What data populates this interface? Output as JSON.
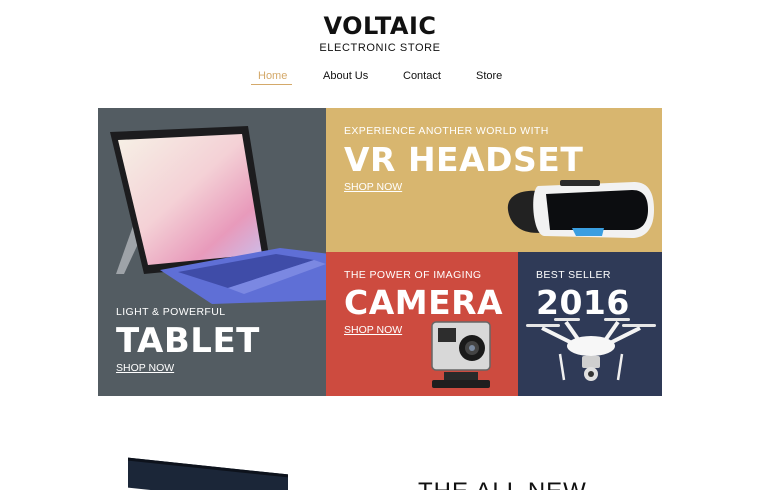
{
  "brand": {
    "title": "VOLTAIC",
    "subtitle": "ELECTRONIC STORE"
  },
  "nav": {
    "items": [
      {
        "label": "Home",
        "active": true
      },
      {
        "label": "About Us",
        "active": false
      },
      {
        "label": "Contact",
        "active": false
      },
      {
        "label": "Store",
        "active": false
      }
    ]
  },
  "colors": {
    "accent": "#d4a96a",
    "tablet_bg": "#535c62",
    "vr_bg": "#d8b66f",
    "camera_bg": "#cd4b3f",
    "drone_bg": "#2f3a57"
  },
  "hero": {
    "tablet": {
      "kicker": "LIGHT & POWERFUL",
      "title": "TABLET",
      "cta": "SHOP NOW"
    },
    "vr": {
      "kicker": "EXPERIENCE ANOTHER WORLD WITH",
      "title": "VR HEADSET",
      "cta": "SHOP NOW"
    },
    "camera": {
      "kicker": "THE POWER OF IMAGING",
      "title": "CAMERA",
      "cta": "SHOP NOW"
    },
    "drone": {
      "kicker": "BEST SELLER",
      "title": "2016"
    }
  },
  "teaser": {
    "title": "THE ALL NEW"
  }
}
